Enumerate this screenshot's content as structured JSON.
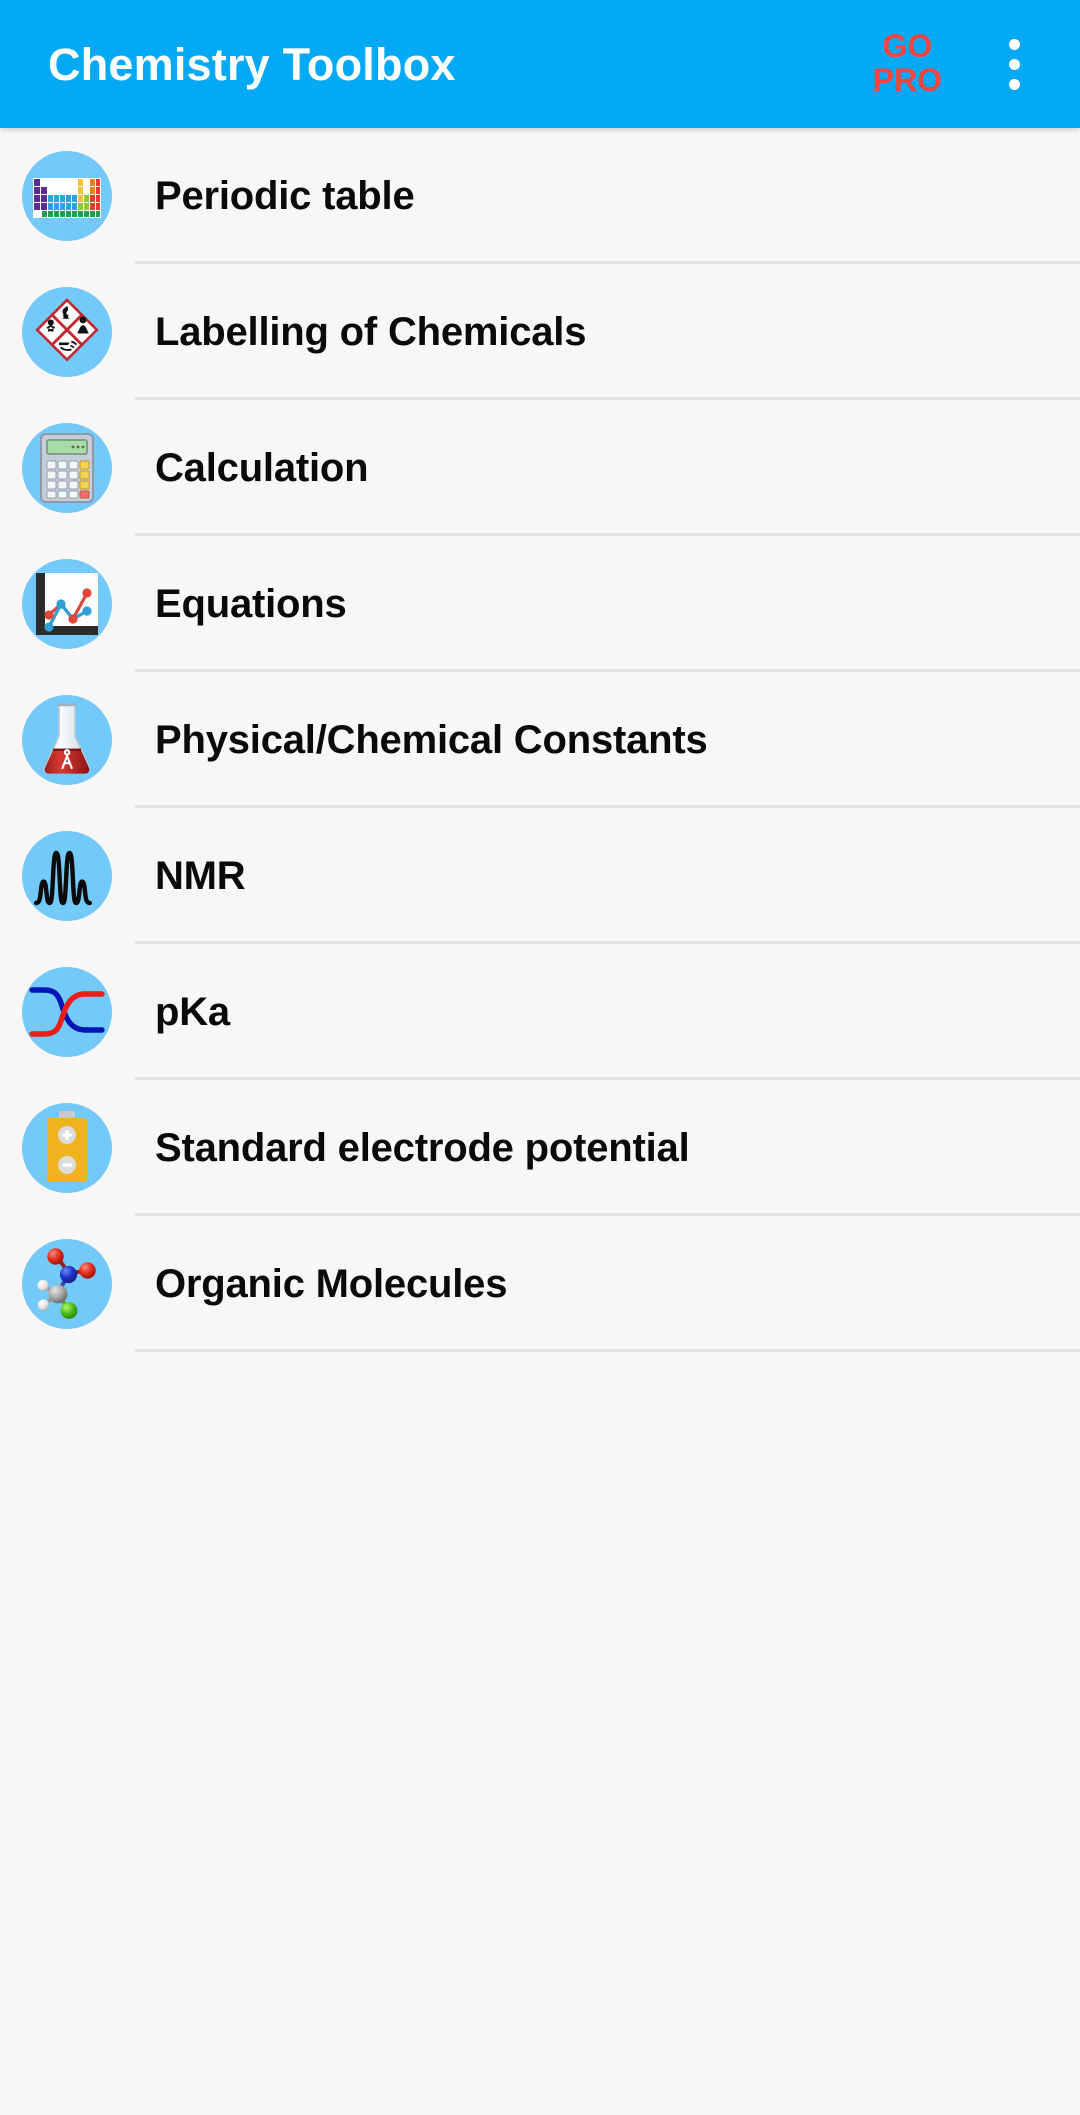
{
  "appbar": {
    "title": "Chemistry Toolbox",
    "go_pro_line1": "GO",
    "go_pro_line2": "PRO",
    "overflow_icon": "more-vertical-icon",
    "background_color": "#03A9F4",
    "title_color": "#FFFFFF",
    "go_pro_color": "#F4453F"
  },
  "theme": {
    "page_background": "#F7F7F7",
    "divider_color": "#E2E2E2",
    "icon_circle_color": "#73C9F7",
    "label_color": "#0A0A0A"
  },
  "list": {
    "items": [
      {
        "label": "Periodic table",
        "icon": "periodic-table-icon"
      },
      {
        "label": "Labelling of Chemicals",
        "icon": "ghs-hazard-pictograms-icon"
      },
      {
        "label": "Calculation",
        "icon": "calculator-icon"
      },
      {
        "label": "Equations",
        "icon": "line-chart-icon"
      },
      {
        "label": "Physical/Chemical Constants",
        "icon": "erlenmeyer-flask-icon"
      },
      {
        "label": "NMR",
        "icon": "nmr-spectrum-peaks-icon"
      },
      {
        "label": "pKa",
        "icon": "titration-curves-icon"
      },
      {
        "label": "Standard electrode potential",
        "icon": "battery-icon"
      },
      {
        "label": "Organic Molecules",
        "icon": "molecule-ball-and-stick-icon"
      }
    ]
  }
}
